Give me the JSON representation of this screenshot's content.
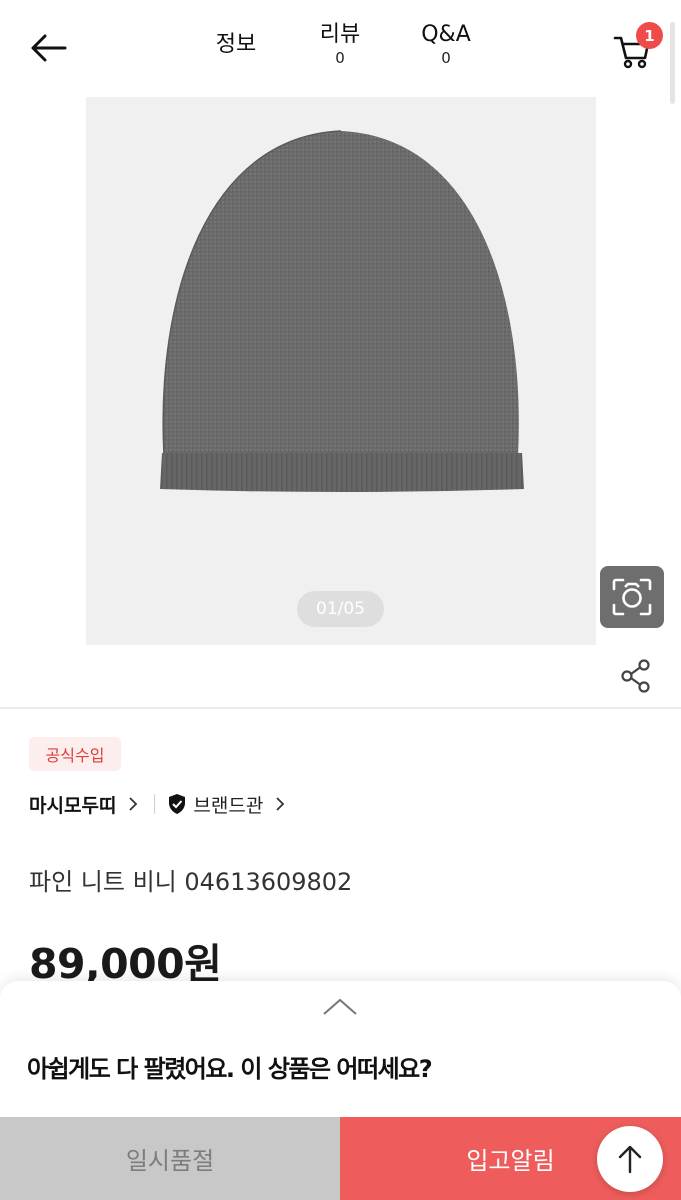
{
  "header": {
    "tabs": [
      {
        "label": "정보",
        "count": ""
      },
      {
        "label": "리뷰",
        "count": "0"
      },
      {
        "label": "Q&A",
        "count": "0"
      }
    ],
    "cart_badge": "1",
    "icons": {
      "back": "arrow-left-icon",
      "cart": "cart-icon"
    }
  },
  "gallery": {
    "counter": "01/05",
    "icons": {
      "lens": "camera-search-icon",
      "share": "share-icon"
    },
    "image": "gray-knit-beanie"
  },
  "product": {
    "badge": "공식수입",
    "brand": "마시모두띠",
    "brand_hall": "브랜드관",
    "title": "파인 니트 비니 04613609802",
    "price": "89,000원"
  },
  "sheet": {
    "message": "아쉽게도 다 팔렸어요. 이 상품은 어떠세요?"
  },
  "bottom_bar": {
    "soldout_label": "일시품절",
    "restock_label": "입고알림"
  },
  "colors": {
    "accent": "#ee5d5b",
    "badge_bg": "#fdeeee",
    "badge_text": "#e23a3a",
    "soldout_bg": "#c8c8c8"
  }
}
